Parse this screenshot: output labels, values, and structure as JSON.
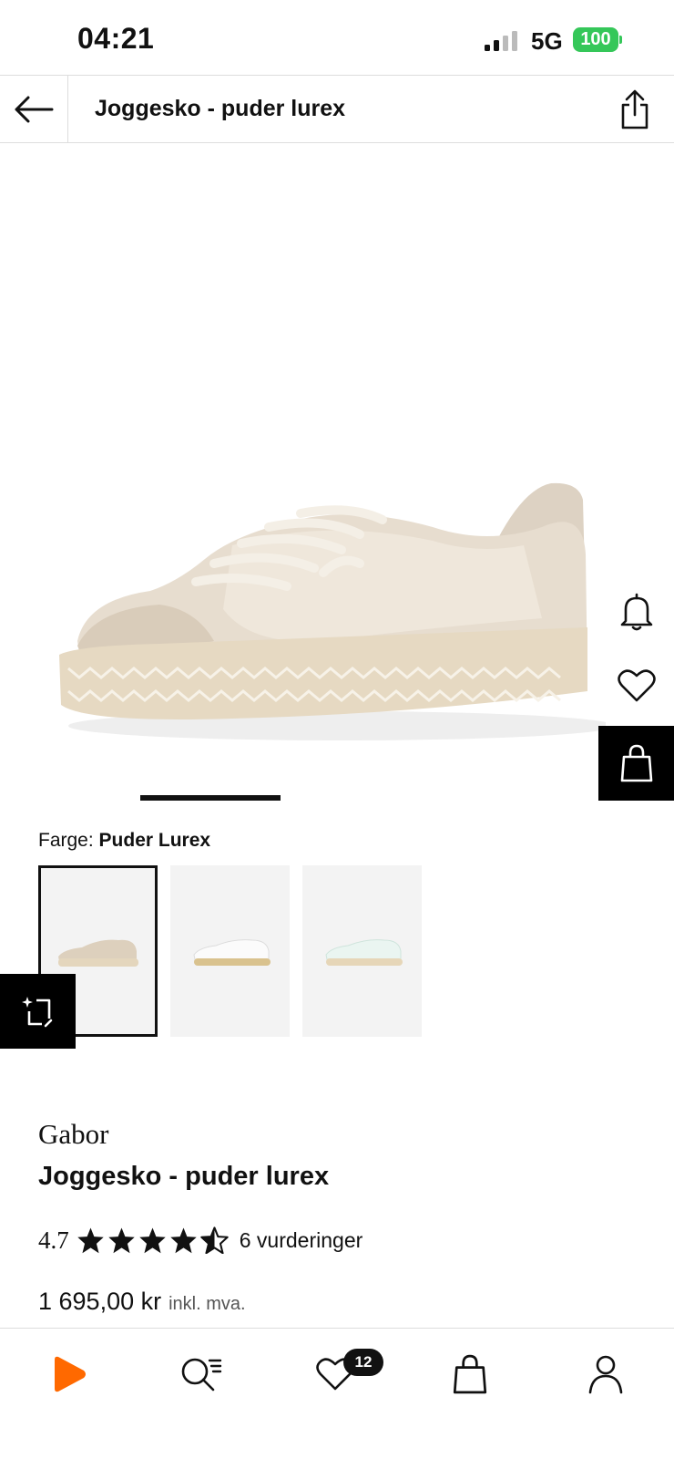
{
  "status_bar": {
    "time": "04:21",
    "network": "5G",
    "battery": "100"
  },
  "header": {
    "title": "Joggesko - puder lurex"
  },
  "color": {
    "label": "Farge:",
    "value": "Puder Lurex"
  },
  "product": {
    "brand": "Gabor",
    "name": "Joggesko - puder lurex",
    "rating": "4.7",
    "rating_stars": 4.7,
    "reviews": "6 vurderinger",
    "price": "1 695,00 kr",
    "vat_note": "inkl. mva."
  },
  "tabs": {
    "wishlist_count": "12"
  },
  "colors": {
    "accent": "#ff6900",
    "battery": "#35c759"
  }
}
